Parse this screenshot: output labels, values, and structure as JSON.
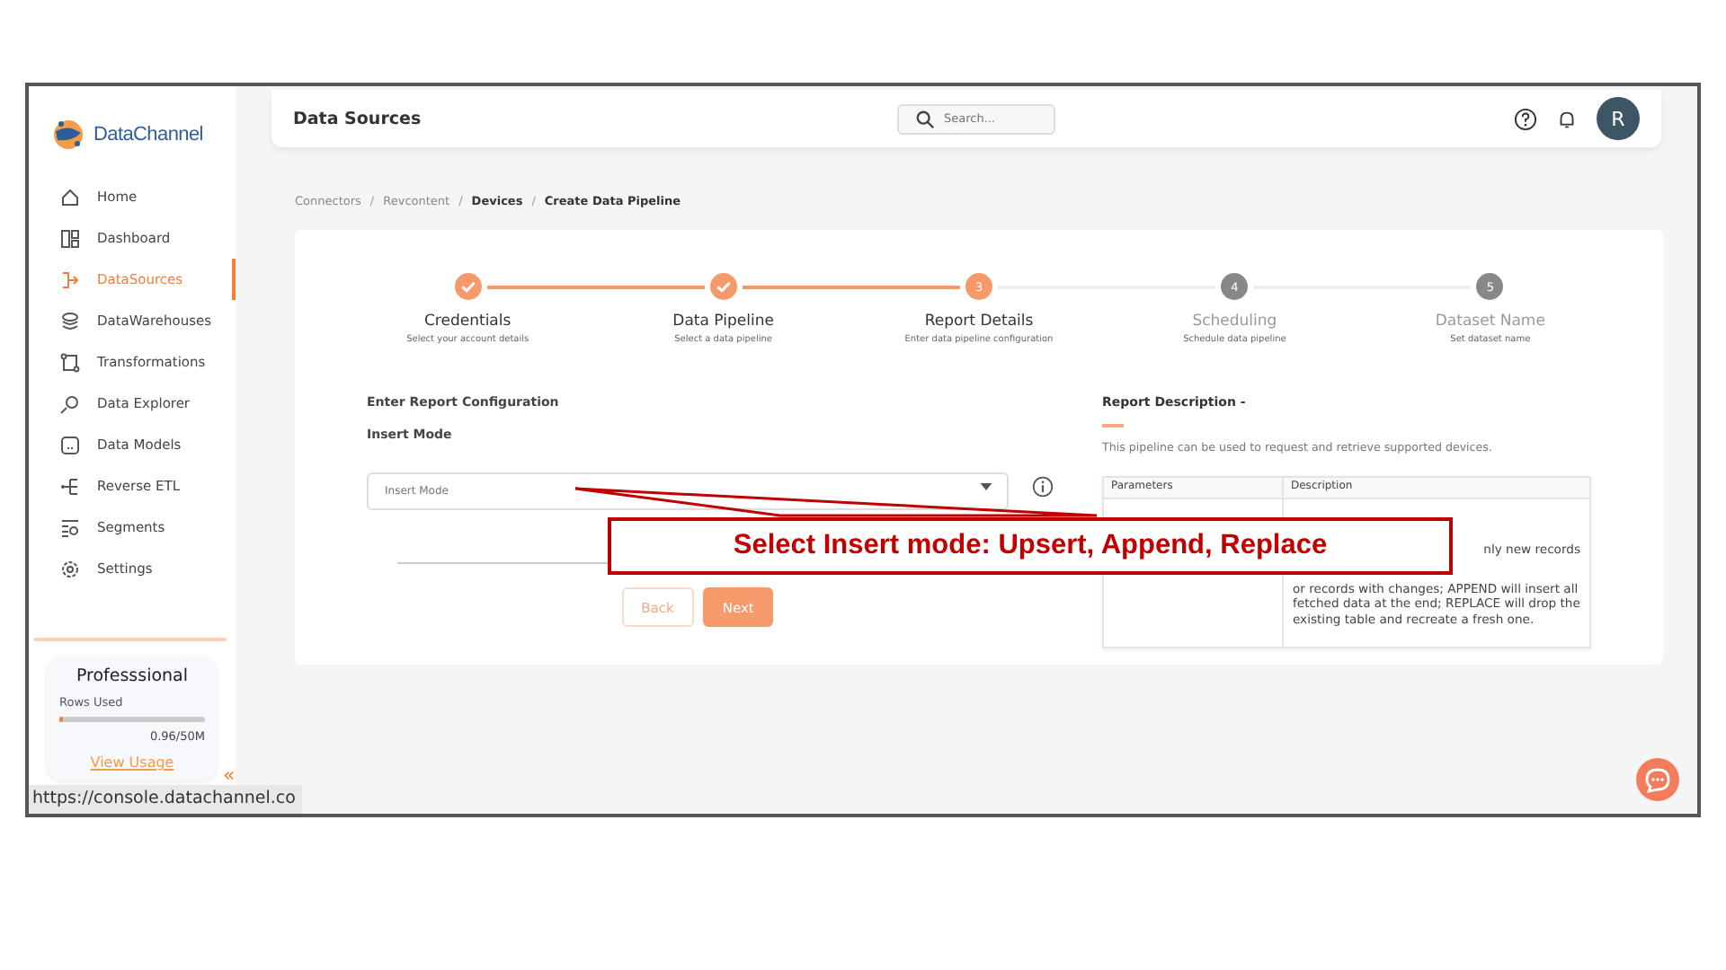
{
  "sidebar": {
    "logo": "DataChannel",
    "items": [
      {
        "label": "Home",
        "selected": false
      },
      {
        "label": "Dashboard",
        "selected": false
      },
      {
        "label": "DataSources",
        "selected": true
      },
      {
        "label": "DataWarehouses",
        "selected": false
      },
      {
        "label": "Transformations",
        "selected": false
      },
      {
        "label": "Data Explorer",
        "selected": false
      },
      {
        "label": "Data Models",
        "selected": false
      },
      {
        "label": "Reverse ETL",
        "selected": false
      },
      {
        "label": "Segments",
        "selected": false
      },
      {
        "label": "Settings",
        "selected": false
      }
    ],
    "plan": {
      "title": "Professsional",
      "label": "Rows Used",
      "level": 0.02,
      "reading": "0.96/50M",
      "link": "View Usage"
    },
    "collapse": "«"
  },
  "header": {
    "title": "Data Sources",
    "search": {
      "placeholder": "Search..."
    },
    "avatar": "R"
  },
  "breadcrumb": [
    {
      "label": "Connectors",
      "current": false
    },
    {
      "separator": "/",
      "label": "Revcontent",
      "current": false
    },
    {
      "separator": "/",
      "label": "Devices",
      "current": true
    },
    {
      "separator": "/",
      "label": "Create Data Pipeline",
      "current": true
    }
  ],
  "steps": [
    {
      "title": "Credentials",
      "subtitle": "Select your account details",
      "completed": true,
      "selected": false
    },
    {
      "title": "Data Pipeline",
      "subtitle": "Select a data pipeline",
      "completed": true,
      "selected": false
    },
    {
      "title": "Report Details",
      "subtitle": "Enter data pipeline configuration",
      "completed": false,
      "selected": true,
      "number": "3"
    },
    {
      "title": "Scheduling",
      "subtitle": "Schedule data pipeline",
      "completed": false,
      "selected": false,
      "number": "4"
    },
    {
      "title": "Dataset Name",
      "subtitle": "Set dataset name",
      "completed": false,
      "selected": false,
      "number": "5"
    }
  ],
  "form": {
    "heading": "Enter Report Configuration",
    "field_label": "Insert Mode",
    "field": {
      "placeholder": "Insert Mode"
    },
    "buttons": [
      {
        "label": "Back",
        "kind": "secondary"
      },
      {
        "label": "Next",
        "kind": "primary"
      }
    ]
  },
  "report": {
    "heading": "Report Description -",
    "text": "This pipeline can be used to request and retrieve supported devices.",
    "table": {
      "columns": [
        "Parameters",
        "Description"
      ],
      "fragment": "nly new records",
      "description": "or records with changes; APPEND will insert all fetched data at the end; REPLACE will drop the existing table and recreate a fresh one."
    }
  },
  "callout": "Select Insert mode: Upsert, Append, Replace",
  "status_url": "https://console.datachannel.co"
}
